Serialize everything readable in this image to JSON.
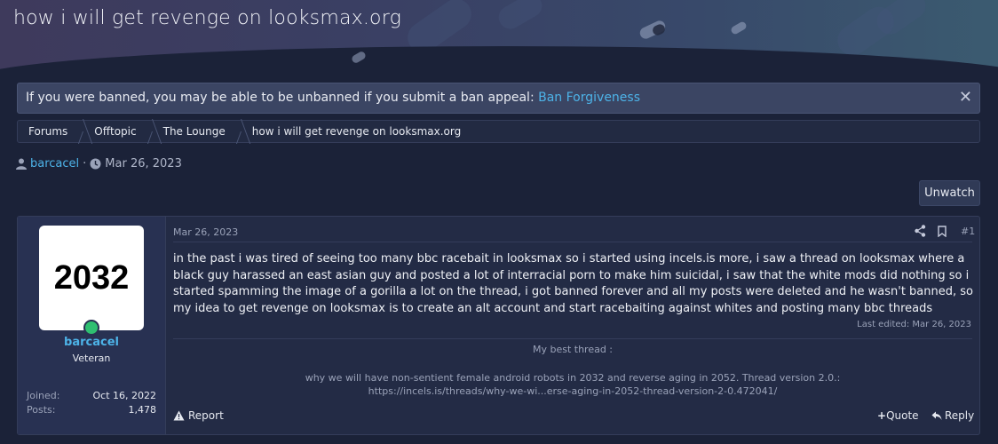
{
  "header": {
    "title": "how i will get revenge on looksmax.org"
  },
  "notice": {
    "text": "If you were banned, you may be able to be unbanned if you submit a ban appeal: ",
    "link": "Ban Forgiveness",
    "close_icon": "close-icon"
  },
  "breadcrumb": [
    "Forums",
    "Offtopic",
    "The Lounge",
    "how i will get revenge on looksmax.org"
  ],
  "thread_meta": {
    "author": "barcacel",
    "separator": "·",
    "date": "Mar 26, 2023"
  },
  "actions": {
    "unwatch": "Unwatch"
  },
  "post": {
    "avatar_text": "2032",
    "username": "barcacel",
    "user_title": "Veteran",
    "stats": [
      {
        "label": "Joined:",
        "value": "Oct 16, 2022"
      },
      {
        "label": "Posts:",
        "value": "1,478"
      }
    ],
    "date": "Mar 26, 2023",
    "number": "#1",
    "body": "in the past i was tired of seeing too many bbc racebait in looksmax so i started using incels.is more, i saw a thread on looksmax where a black guy harassed an east asian guy and posted a lot of interracial porn to make him suicidal, i saw that the white mods did nothing so i started spamming the image of a gorilla a lot on the thread, i got banned forever and all my posts were deleted and he wasn't banned, so my idea to get revenge on looksmax is to create an alt account and start racebaiting against whites and posting many bbc threads",
    "last_edited": "Last edited: Mar 26, 2023",
    "signature": {
      "heading": "My best thread :",
      "line1": "why we will have non-sentient female android robots in 2032 and reverse aging in 2052. Thread version 2.0.:",
      "line2": "https://incels.is/threads/why-we-wi...erse-aging-in-2052-thread-version-2-0.472041/"
    },
    "report": "Report",
    "quote": "Quote",
    "reply": "Reply"
  },
  "colors": {
    "background": "#1b2238",
    "link": "#4db3e8",
    "online": "#2fbf71"
  }
}
